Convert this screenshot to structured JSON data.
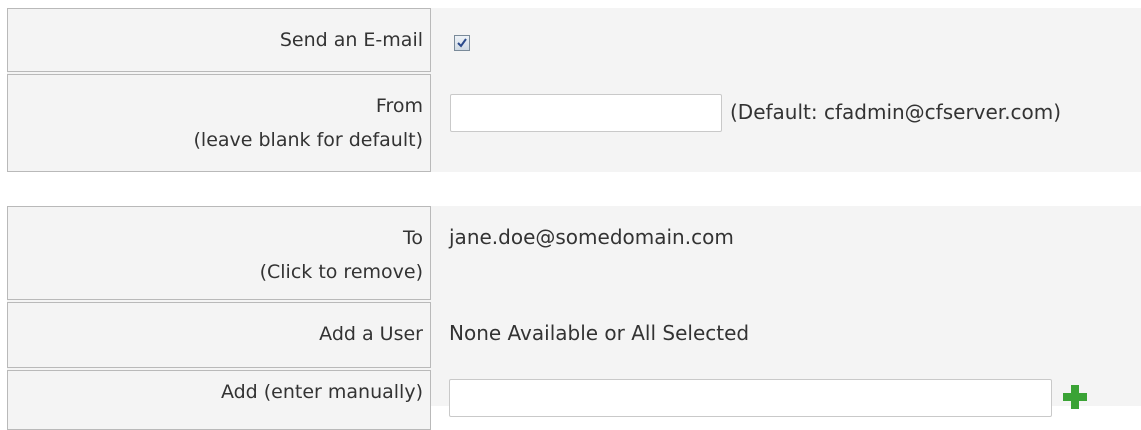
{
  "send_email": {
    "label": "Send an E-mail",
    "checked": true
  },
  "from": {
    "label_line1": "From",
    "label_line2": "(leave blank for default)",
    "value": "",
    "default_hint": "(Default: cfadmin@cfserver.com)"
  },
  "to": {
    "label_line1": "To",
    "label_line2": "(Click to remove)",
    "recipients": [
      "jane.doe@somedomain.com"
    ]
  },
  "add_user": {
    "label": "Add a User",
    "value": "None Available or All Selected"
  },
  "add_manual": {
    "label": "Add (enter manually)",
    "value": "",
    "add_icon": "plus-icon"
  },
  "colors": {
    "panel_bg": "#f4f4f4",
    "border": "#b9b9b9",
    "text": "#333333",
    "plus_green": "#3aa335"
  }
}
